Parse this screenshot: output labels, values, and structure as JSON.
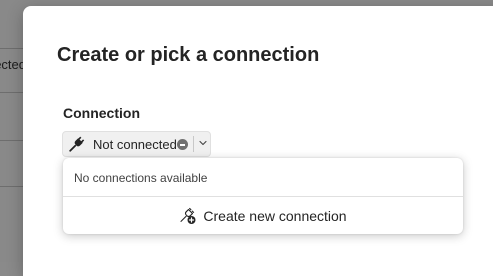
{
  "background": {
    "cell_text": "ected"
  },
  "dialog": {
    "title": "Create or pick a connection",
    "connection_label": "Connection",
    "combo": {
      "value": "Not connected",
      "icon": "plug-icon",
      "status_icon": "status-minus-icon",
      "chevron_icon": "chevron-down-icon"
    },
    "dropdown": {
      "empty_message": "No connections available",
      "create_label": "Create new connection",
      "create_icon": "add-plug-icon"
    }
  }
}
